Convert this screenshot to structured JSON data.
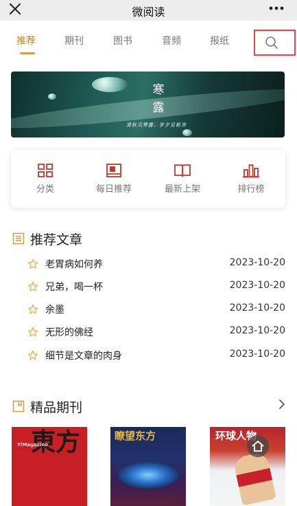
{
  "header": {
    "title": "微阅读"
  },
  "tabs": [
    {
      "label": "推荐",
      "active": true
    },
    {
      "label": "期刊",
      "active": false
    },
    {
      "label": "图书",
      "active": false
    },
    {
      "label": "音频",
      "active": false
    },
    {
      "label": "报纸",
      "active": false
    }
  ],
  "banner": {
    "title_line1": "寒",
    "title_line2": "露",
    "subtitle": "清秋沉寒露，岁夕见新凉"
  },
  "shortcuts": [
    {
      "label": "分类",
      "icon": "grid-icon"
    },
    {
      "label": "每日推荐",
      "icon": "bookmark-card-icon"
    },
    {
      "label": "最新上架",
      "icon": "open-book-icon"
    },
    {
      "label": "排行榜",
      "icon": "bar-chart-icon"
    }
  ],
  "recommended": {
    "heading": "推荐文章",
    "items": [
      {
        "title": "老胃病如何养",
        "date": "2023-10-20"
      },
      {
        "title": "兄弟，喝一杯",
        "date": "2023-10-20"
      },
      {
        "title": "余墨",
        "date": "2023-10-20"
      },
      {
        "title": "无形的佛经",
        "date": "2023-10-20"
      },
      {
        "title": "细节是文章的肉身",
        "date": "2023-10-20"
      }
    ]
  },
  "journals": {
    "heading": "精品期刊",
    "covers": [
      {
        "title": "东方Boy",
        "masthead": "YiMagazine",
        "big": "東方"
      },
      {
        "title": "瞭望东方",
        "masthead": ""
      },
      {
        "title": "环球人物",
        "masthead": ""
      }
    ]
  },
  "colors": {
    "accent": "#c8892b",
    "icon_red": "#c0392b",
    "search_highlight": "#e0474c",
    "star": "#e7b24c"
  }
}
